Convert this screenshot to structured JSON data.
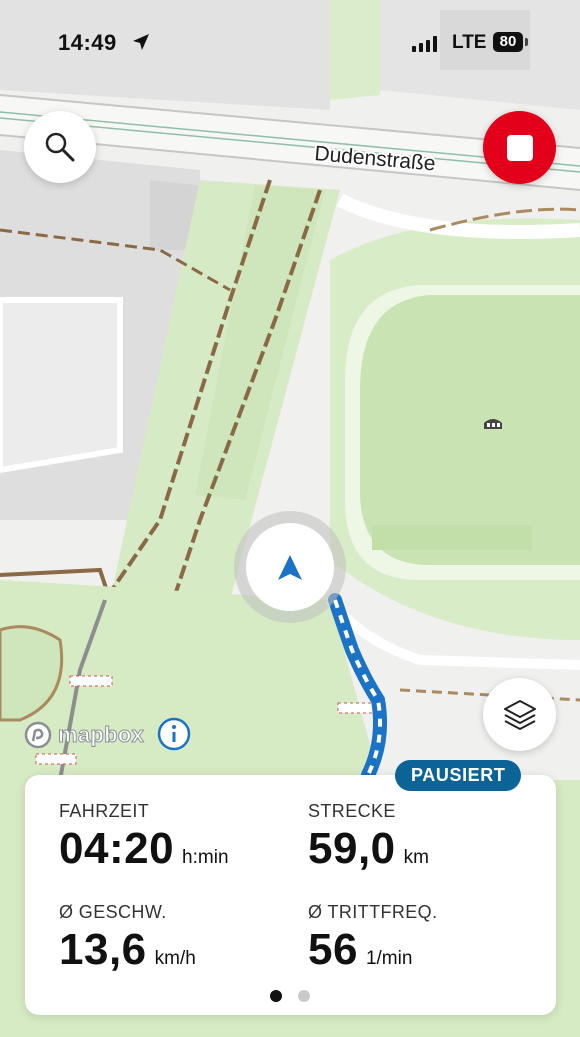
{
  "status_bar": {
    "time": "14:49",
    "network": "LTE",
    "battery": "80"
  },
  "map": {
    "street_label": "Dudenstraße",
    "attribution": "mapbox"
  },
  "controls": {
    "search_icon": "magnifier-icon",
    "stop_icon": "stop-icon",
    "layers_icon": "layers-icon",
    "info_icon": "info-icon"
  },
  "tracking": {
    "status_badge": "PAUSIERT",
    "stats": [
      {
        "label": "FAHRZEIT",
        "value": "04:20",
        "unit": "h:min"
      },
      {
        "label": "STRECKE",
        "value": "59,0",
        "unit": "km"
      },
      {
        "label": "Ø GESCHW.",
        "value": "13,6",
        "unit": "km/h"
      },
      {
        "label": "Ø TRITTFREQ.",
        "value": "56",
        "unit": "1/min"
      }
    ],
    "page_indicator": {
      "pages": 2,
      "current": 1
    }
  },
  "colors": {
    "stop": "#e3001b",
    "route": "#1a73c4",
    "badge": "#0c6496",
    "park": "#d9ecc8",
    "field": "#cde6b7"
  }
}
